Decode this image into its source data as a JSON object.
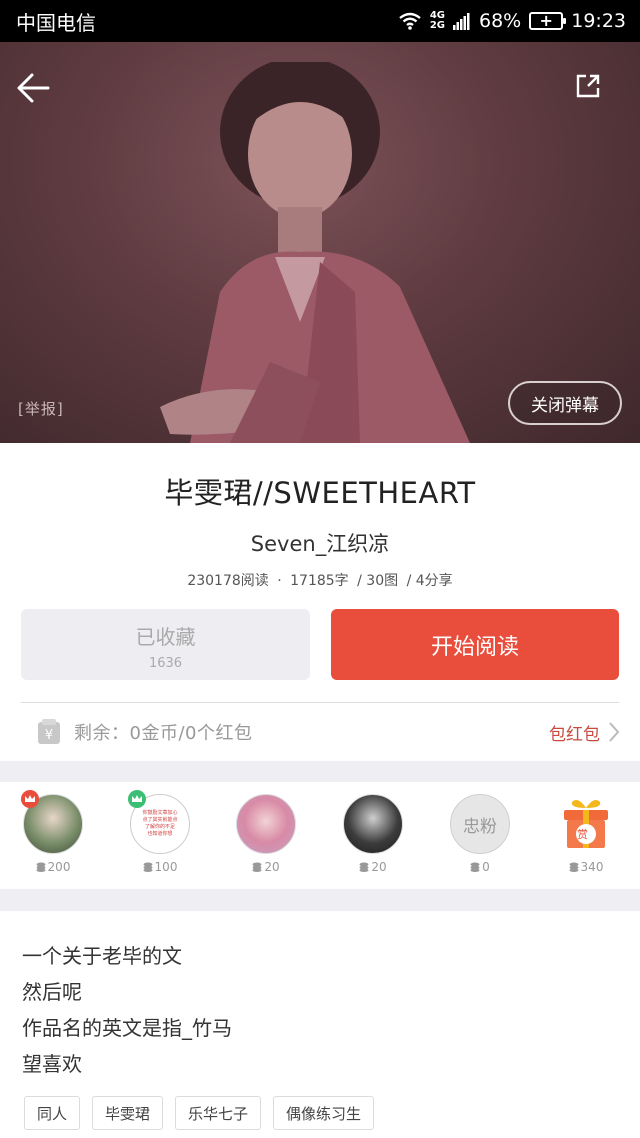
{
  "status_bar": {
    "carrier": "中国电信",
    "network_top": "4G",
    "network_bottom": "2G",
    "battery": "68%",
    "time": "19:23"
  },
  "hero": {
    "report": "[举报]",
    "close_danmaku": "关闭弹幕"
  },
  "work": {
    "title": "毕雯珺//SWEETHEART",
    "author": "Seven_江织凉",
    "reads": "230178阅读",
    "dot": "·",
    "words": "17185字",
    "images": "/ 30图",
    "shares": "/ 4分享"
  },
  "actions": {
    "favorited_label": "已收藏",
    "favorited_count": "1636",
    "start_reading": "开始阅读"
  },
  "balance": {
    "text": "剩余：0金币/0个红包",
    "redpack_label": "包红包",
    "icon": "coin-yen-icon"
  },
  "fans": [
    {
      "amount": "200",
      "badge": "crown-red"
    },
    {
      "amount": "100",
      "badge": "crown-green",
      "avatar_text": [
        "你鼓励文章加心",
        "点了其实就能点",
        "了解你的不足",
        "也知道你想"
      ]
    },
    {
      "amount": "20"
    },
    {
      "amount": "20"
    },
    {
      "amount": "0",
      "label": "忠粉"
    },
    {
      "amount": "340",
      "label": "赏"
    }
  ],
  "description": {
    "lines": [
      "一个关于老毕的文",
      "然后呢",
      "作品名的英文是指_竹马",
      "望喜欢"
    ]
  },
  "tags": [
    "同人",
    "毕雯珺",
    "乐华七子",
    "偶像练习生"
  ],
  "colors": {
    "accent": "#e94e3c",
    "redpack": "#c84a3f"
  }
}
